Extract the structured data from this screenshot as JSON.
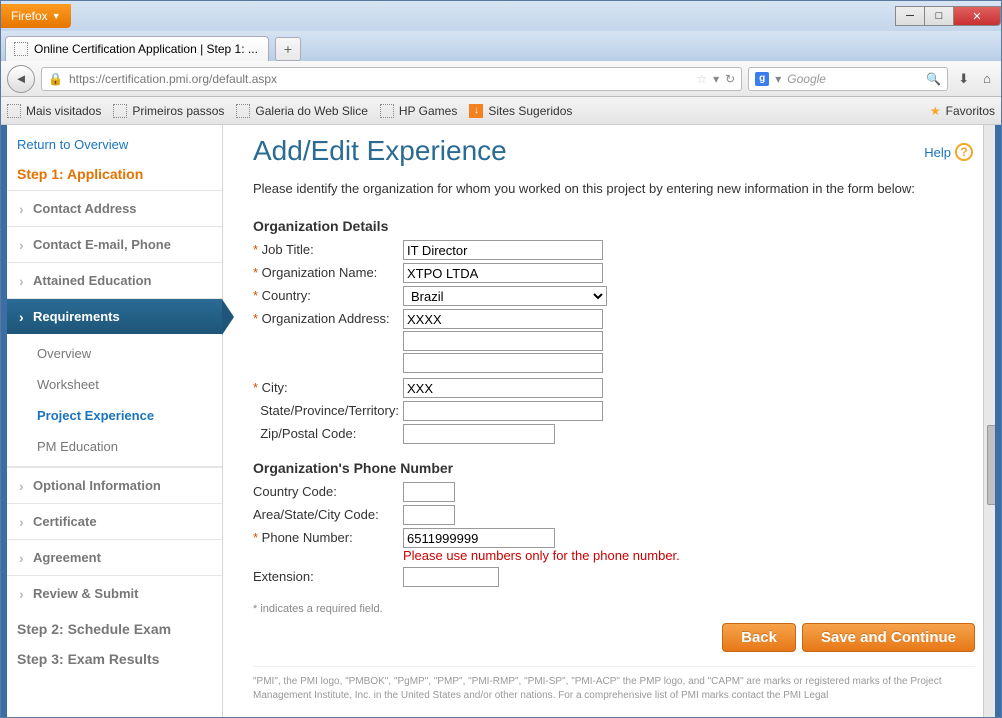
{
  "browser": {
    "name": "Firefox",
    "tab_title": "Online Certification Application | Step 1: ...",
    "url": "https://certification.pmi.org/default.aspx",
    "search_placeholder": "Google"
  },
  "bookmarks": {
    "items": [
      "Mais visitados",
      "Primeiros passos",
      "Galeria do Web Slice",
      "HP Games",
      "Sites Sugeridos"
    ],
    "fav_label": "Favoritos"
  },
  "sidebar": {
    "return": "Return to Overview",
    "step1": "Step 1: Application",
    "items": [
      "Contact Address",
      "Contact E-mail, Phone",
      "Attained Education",
      "Requirements",
      "Optional Information",
      "Certificate",
      "Agreement",
      "Review & Submit"
    ],
    "subs": [
      "Overview",
      "Worksheet",
      "Project Experience",
      "PM Education"
    ],
    "step2": "Step 2: Schedule Exam",
    "step3": "Step 3: Exam Results"
  },
  "main": {
    "help": "Help",
    "title": "Add/Edit Experience",
    "intro": "Please identify the organization for whom you worked on this project by entering new information in the form below:",
    "section1": "Organization Details",
    "labels": {
      "job_title": "Job Title:",
      "org_name": "Organization Name:",
      "country": "Country:",
      "org_addr": "Organization Address:",
      "city": "City:",
      "state": "State/Province/Territory:",
      "zip": "Zip/Postal Code:"
    },
    "values": {
      "job_title": "IT Director",
      "org_name": "XTPO LTDA",
      "country": "Brazil",
      "addr1": "XXXX",
      "city": "XXX"
    },
    "section2": "Organization's Phone Number",
    "phone_labels": {
      "country_code": "Country Code:",
      "area_code": "Area/State/City Code:",
      "phone": "Phone Number:",
      "ext": "Extension:"
    },
    "phone_values": {
      "phone": "6511999999"
    },
    "error": "Please use numbers only for the phone number.",
    "required_note": "* indicates a required field.",
    "back": "Back",
    "save": "Save and Continue",
    "footer": "\"PMI\", the PMI logo, \"PMBOK\", \"PgMP\", \"PMP\", \"PMI-RMP\", \"PMI-SP\", \"PMI-ACP\" the PMP logo, and \"CAPM\" are marks or registered marks of the Project Management Institute, Inc. in the United States and/or other nations. For a comprehensive list of PMI marks contact the PMI Legal"
  }
}
